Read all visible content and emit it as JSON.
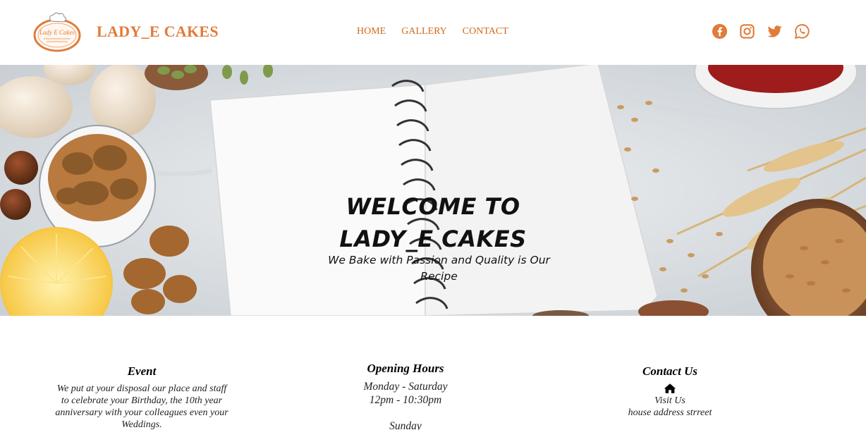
{
  "header": {
    "logo_text": "Lady E Cakes",
    "brand": "LADY_E CAKES",
    "nav": [
      {
        "label": "HOME"
      },
      {
        "label": "GALLERY"
      },
      {
        "label": "CONTACT"
      }
    ],
    "social_icons": [
      "facebook-icon",
      "instagram-icon",
      "twitter-icon",
      "whatsapp-icon"
    ],
    "accent_color": "#e07b39"
  },
  "hero": {
    "title_line1": "WELCOME TO",
    "title_line2": "LADY_E CAKES",
    "subtitle": "We Bake with Passion and Quality is Our Recipe"
  },
  "info": {
    "event": {
      "title": "Event",
      "text": "We put at your disposal our place and staff to celebrate your Birthday, the 10th year anniversary with your colleagues even your Weddings."
    },
    "hours": {
      "title": "Opening Hours",
      "line1": "Monday - Saturday",
      "line2": "12pm - 10:30pm",
      "line3": "Sunday"
    },
    "contact": {
      "title": "Contact Us",
      "icon": "home-icon",
      "visit": "Visit Us",
      "address": "house address strreet"
    }
  }
}
